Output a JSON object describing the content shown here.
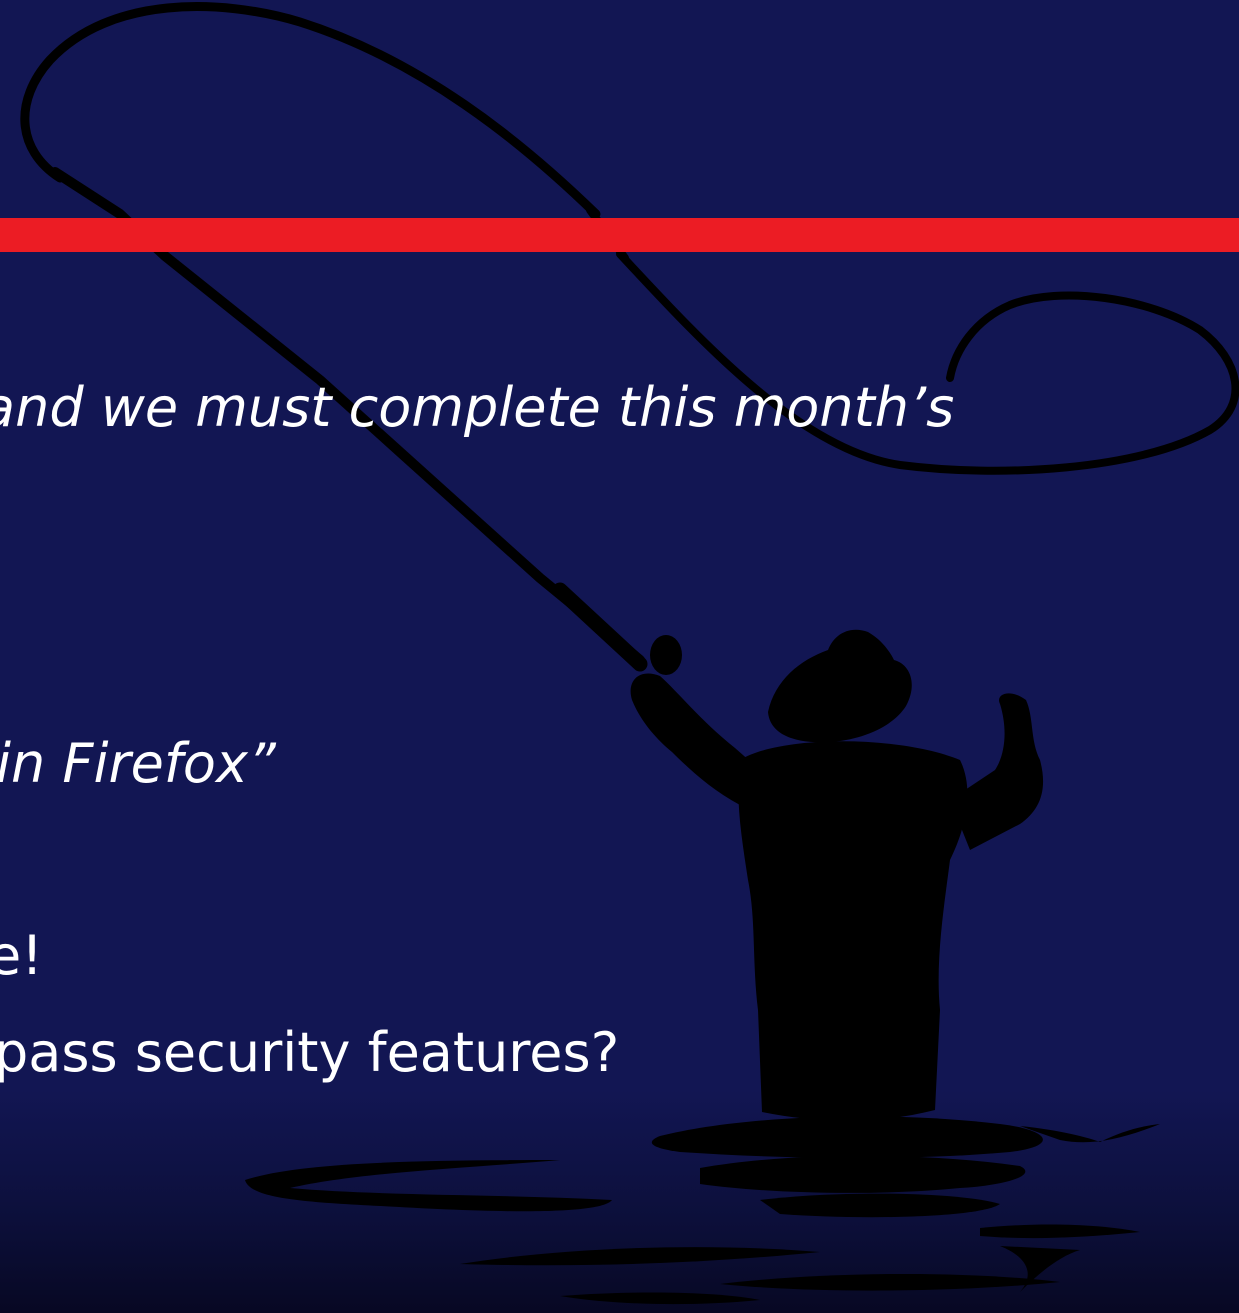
{
  "slide": {
    "colors": {
      "background": "#121653",
      "accent_bar": "#ec1c24",
      "text": "#ffffff",
      "silhouette": "#000000"
    },
    "illustration": "fly-fisherman-silhouette",
    "lines": [
      {
        "text": "and we must complete this month’s",
        "style": "italic"
      },
      {
        "text": "in Firefox”",
        "style": "italic"
      },
      {
        "text": "e!",
        "style": "normal"
      },
      {
        "text": "pass security features?",
        "style": "normal"
      }
    ]
  }
}
